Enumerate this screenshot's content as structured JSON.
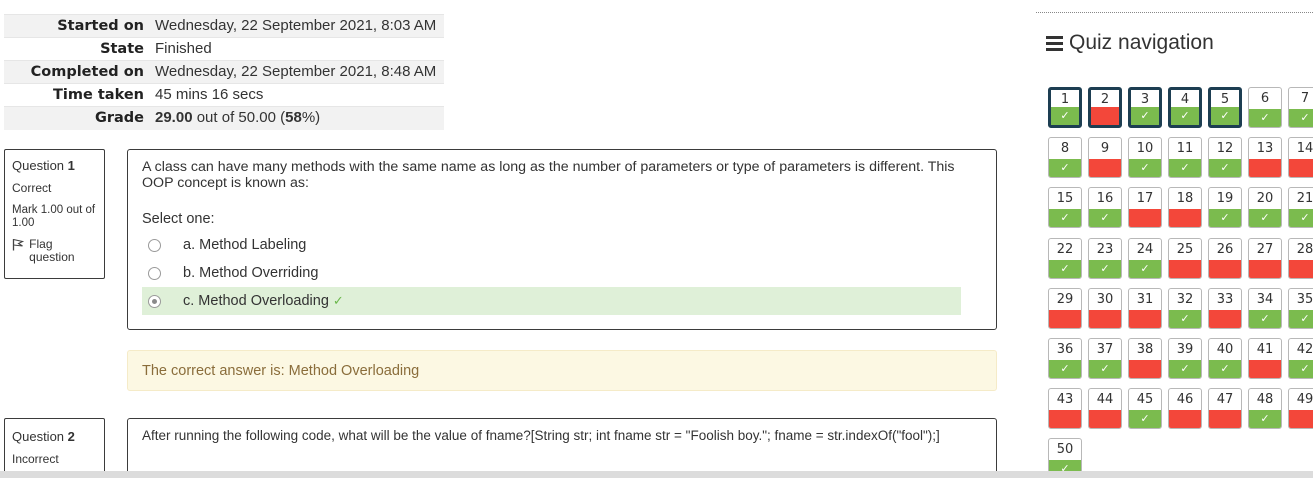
{
  "summary": [
    {
      "label": "Started on",
      "value": "Wednesday, 22 September 2021, 8:03 AM"
    },
    {
      "label": "State",
      "value": "Finished"
    },
    {
      "label": "Completed on",
      "value": "Wednesday, 22 September 2021, 8:48 AM"
    },
    {
      "label": "Time taken",
      "value": "45 mins 16 secs"
    },
    {
      "label": "Grade",
      "value_bold": "29.00",
      "value": " out of 50.00 (",
      "pct_bold": "58",
      "pct_tail": "%)"
    }
  ],
  "question1": {
    "label": "Question ",
    "number": "1",
    "state": "Correct",
    "mark": "Mark 1.00 out of 1.00",
    "flag": "Flag question",
    "text": "A class can have many methods with the same name as long as the number of parameters or type of parameters is different. This OOP concept is known as:",
    "prompt": "Select one:",
    "answers": [
      {
        "label": "a. Method Labeling",
        "checked": false
      },
      {
        "label": "b. Method Overriding",
        "checked": false
      },
      {
        "label": "c. Method Overloading",
        "checked": true
      }
    ],
    "feedback": "The correct answer is: Method Overloading"
  },
  "question2": {
    "label": "Question ",
    "number": "2",
    "state": "Incorrect",
    "text": "After running the following code, what will be the value of fname?[String str; int fname str = \"Foolish boy.\"; fname = str.indexOf(\"fool\");]"
  },
  "nav": {
    "title": "Quiz navigation",
    "icon": "bars-icon",
    "colors": {
      "correct": "#7bbb4e",
      "incorrect": "#f3473a",
      "current_border": "#1d3e52"
    },
    "buttons": [
      {
        "n": "1",
        "s": "correct",
        "current": true
      },
      {
        "n": "2",
        "s": "incorrect",
        "current": true
      },
      {
        "n": "3",
        "s": "correct",
        "current": true
      },
      {
        "n": "4",
        "s": "correct",
        "current": true
      },
      {
        "n": "5",
        "s": "correct",
        "current": true
      },
      {
        "n": "6",
        "s": "correct"
      },
      {
        "n": "7",
        "s": "correct"
      },
      {
        "n": "8",
        "s": "correct"
      },
      {
        "n": "9",
        "s": "incorrect"
      },
      {
        "n": "10",
        "s": "correct"
      },
      {
        "n": "11",
        "s": "correct"
      },
      {
        "n": "12",
        "s": "correct"
      },
      {
        "n": "13",
        "s": "incorrect"
      },
      {
        "n": "14",
        "s": "incorrect"
      },
      {
        "n": "15",
        "s": "correct"
      },
      {
        "n": "16",
        "s": "correct"
      },
      {
        "n": "17",
        "s": "incorrect"
      },
      {
        "n": "18",
        "s": "incorrect"
      },
      {
        "n": "19",
        "s": "correct"
      },
      {
        "n": "20",
        "s": "correct"
      },
      {
        "n": "21",
        "s": "correct"
      },
      {
        "n": "22",
        "s": "correct"
      },
      {
        "n": "23",
        "s": "correct"
      },
      {
        "n": "24",
        "s": "correct"
      },
      {
        "n": "25",
        "s": "incorrect"
      },
      {
        "n": "26",
        "s": "incorrect"
      },
      {
        "n": "27",
        "s": "incorrect"
      },
      {
        "n": "28",
        "s": "incorrect"
      },
      {
        "n": "29",
        "s": "incorrect"
      },
      {
        "n": "30",
        "s": "incorrect"
      },
      {
        "n": "31",
        "s": "incorrect"
      },
      {
        "n": "32",
        "s": "correct"
      },
      {
        "n": "33",
        "s": "incorrect"
      },
      {
        "n": "34",
        "s": "correct"
      },
      {
        "n": "35",
        "s": "correct"
      },
      {
        "n": "36",
        "s": "correct"
      },
      {
        "n": "37",
        "s": "correct"
      },
      {
        "n": "38",
        "s": "incorrect"
      },
      {
        "n": "39",
        "s": "correct"
      },
      {
        "n": "40",
        "s": "correct"
      },
      {
        "n": "41",
        "s": "incorrect"
      },
      {
        "n": "42",
        "s": "correct"
      },
      {
        "n": "43",
        "s": "incorrect"
      },
      {
        "n": "44",
        "s": "incorrect"
      },
      {
        "n": "45",
        "s": "correct"
      },
      {
        "n": "46",
        "s": "incorrect"
      },
      {
        "n": "47",
        "s": "incorrect"
      },
      {
        "n": "48",
        "s": "correct"
      },
      {
        "n": "49",
        "s": "incorrect"
      },
      {
        "n": "50",
        "s": "correct"
      }
    ]
  }
}
